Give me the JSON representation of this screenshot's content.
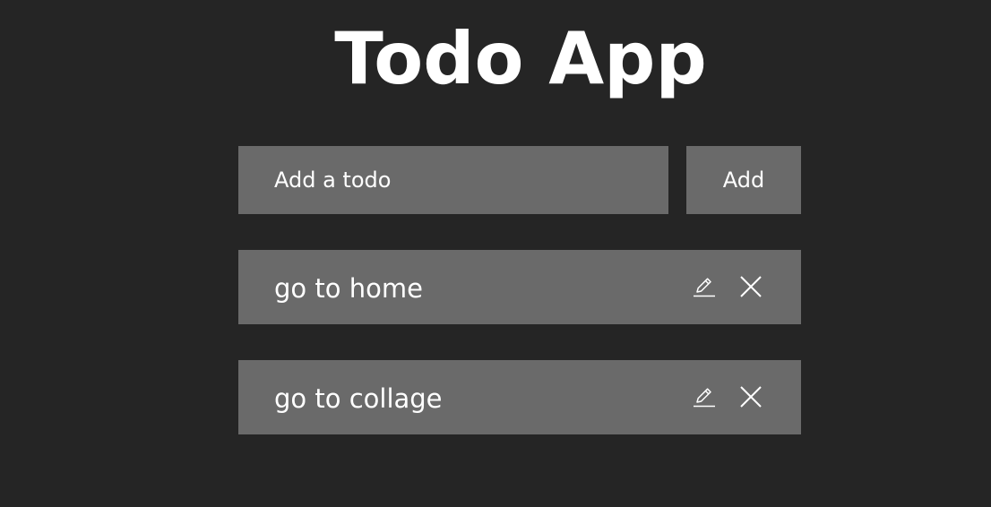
{
  "app": {
    "title": "Todo App"
  },
  "form": {
    "input_placeholder": "Add a todo",
    "input_value": "",
    "add_label": "Add"
  },
  "todos": [
    {
      "text": "go to home",
      "edit_icon": "pencil-icon",
      "delete_icon": "close-icon"
    },
    {
      "text": "go to collage",
      "edit_icon": "pencil-icon",
      "delete_icon": "close-icon"
    }
  ],
  "colors": {
    "background": "#252525",
    "surface": "#6a6a6a",
    "text": "#ffffff"
  }
}
